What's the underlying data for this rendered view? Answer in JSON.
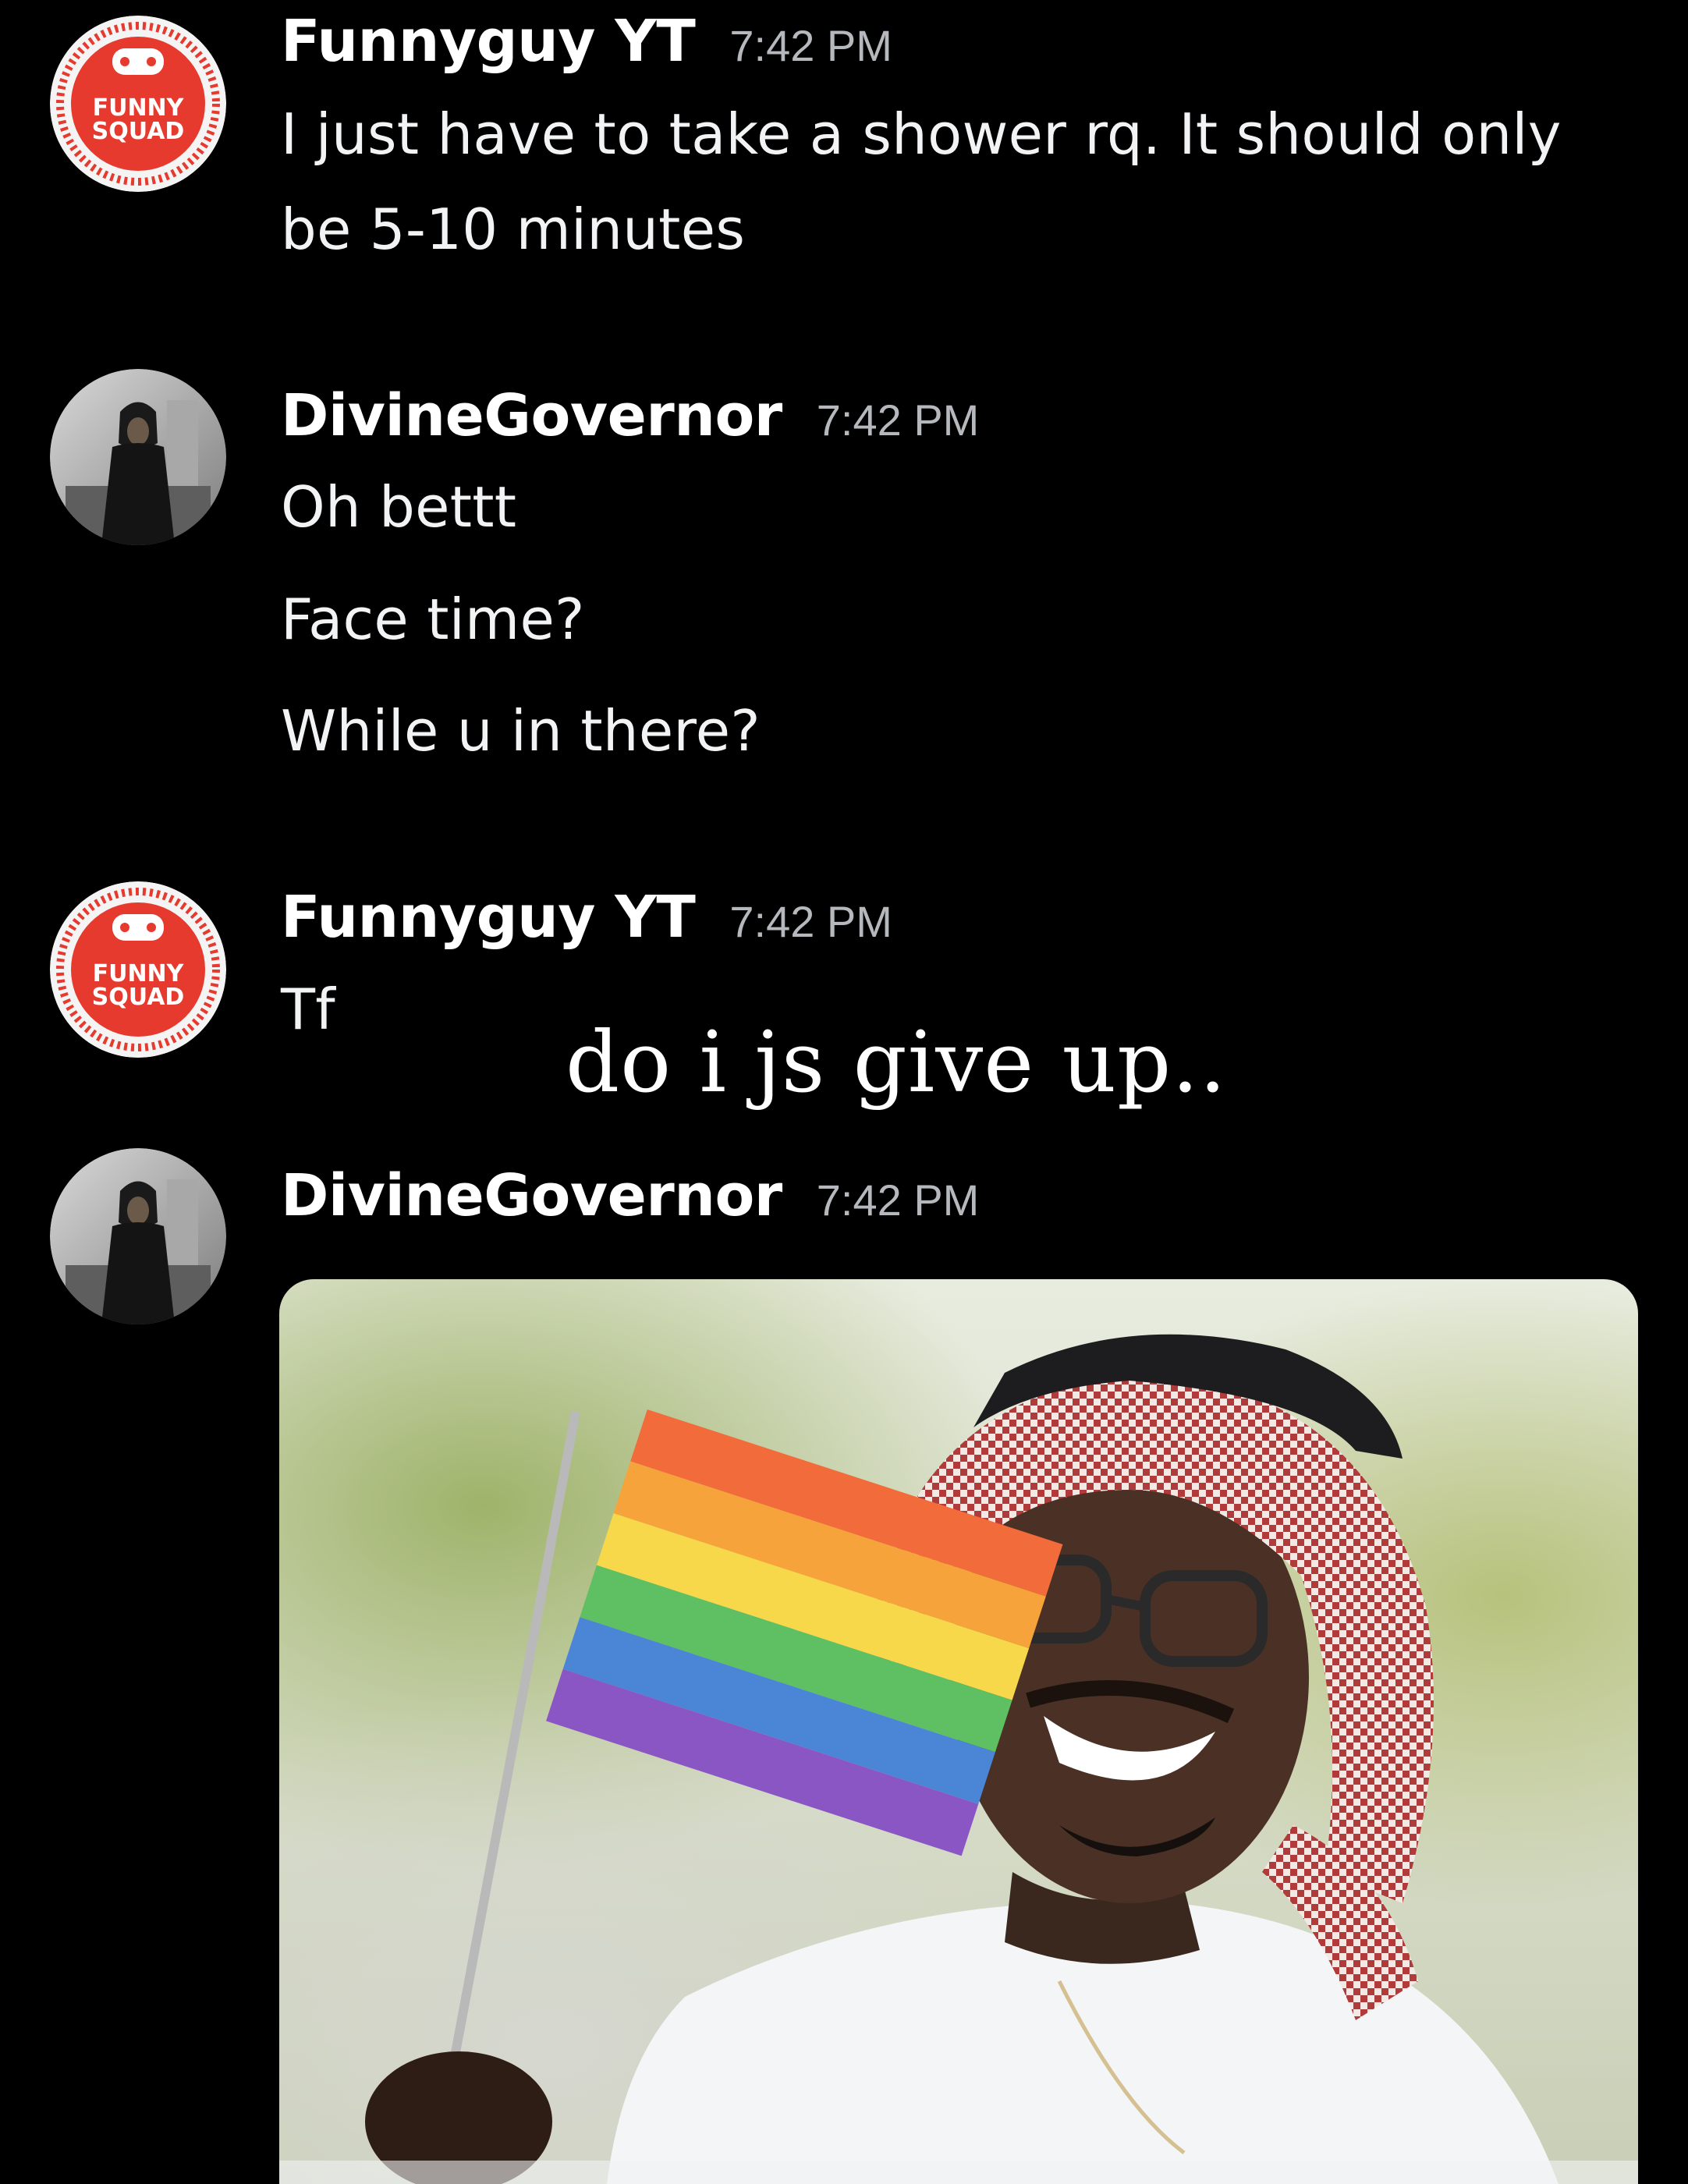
{
  "messages": [
    {
      "author": "Funnyguy YT",
      "time": "7:42 PM",
      "avatar_icon": "funny-squad-logo-icon",
      "avatar_logo_text": [
        "FUNNY",
        "SQUAD"
      ],
      "lines": [
        "I just have to take a shower rq. It should only",
        "be 5-10 minutes"
      ]
    },
    {
      "author": "DivineGovernor",
      "time": "7:42 PM",
      "avatar_icon": "hooded-person-avatar-icon",
      "lines": [
        "Oh bettt",
        "Face time?",
        "While u in there?"
      ]
    },
    {
      "author": "Funnyguy YT",
      "time": "7:42 PM",
      "avatar_icon": "funny-squad-logo-icon",
      "avatar_logo_text": [
        "FUNNY",
        "SQUAD"
      ],
      "lines": [
        "Tf"
      ]
    },
    {
      "author": "DivineGovernor",
      "time": "7:42 PM",
      "avatar_icon": "hooded-person-avatar-icon",
      "attachment": "gif-smiling-man-waving-rainbow-flag"
    }
  ],
  "overlay_caption": "do i js give up..",
  "colors": {
    "background": "#000000",
    "username": "#ffffff",
    "message_text": "#f2f3f5",
    "timestamp": "#b5b8bd",
    "logo_red": "#e63a2e"
  }
}
